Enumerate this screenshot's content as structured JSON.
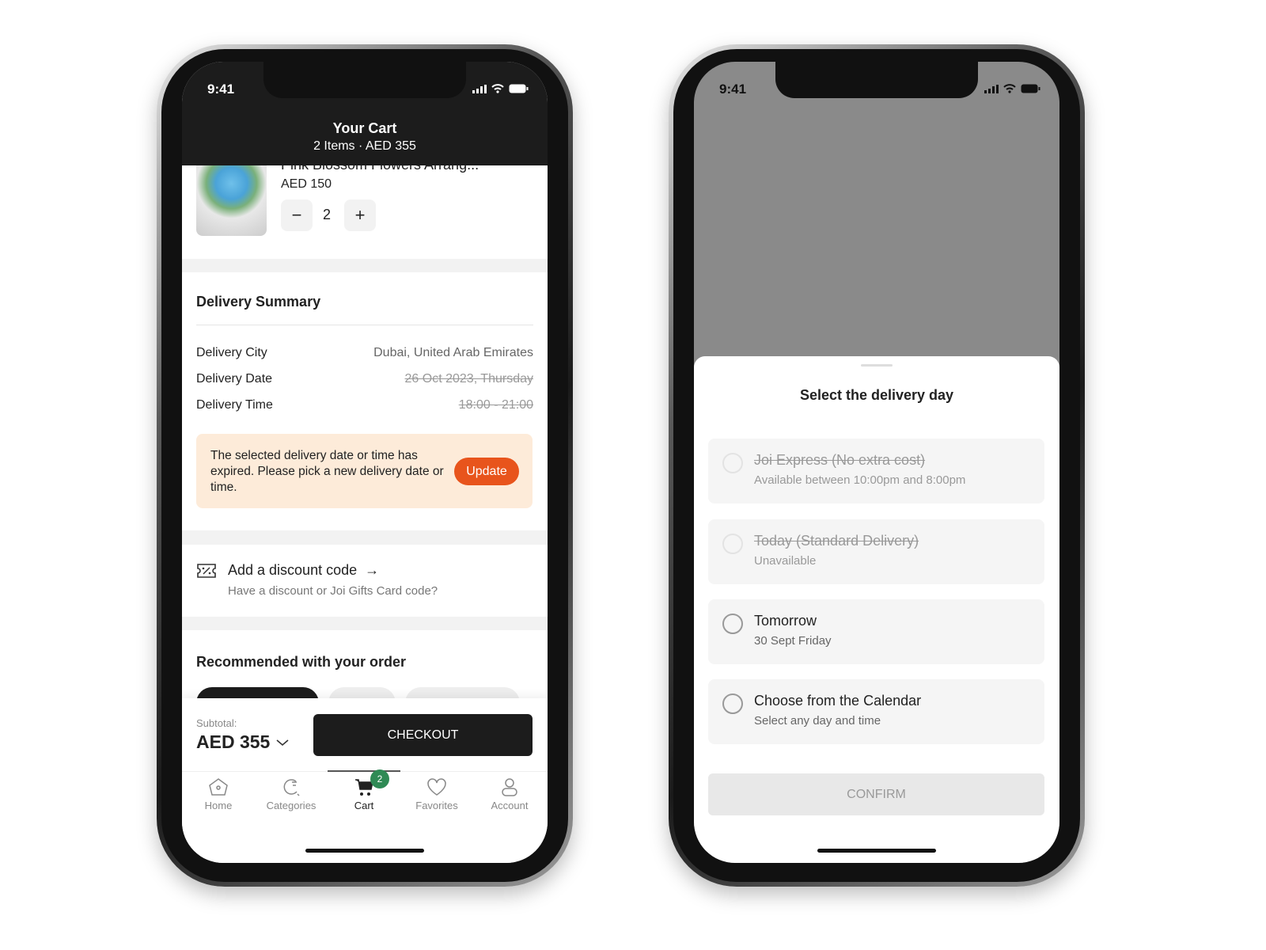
{
  "status": {
    "time": "9:41"
  },
  "cart": {
    "title": "Your Cart",
    "subtitle": "2 Items · AED 355",
    "item": {
      "name": "Pink Blossom Flowers Arrang...",
      "price": "AED 150",
      "quantity": "2"
    },
    "delivery": {
      "heading": "Delivery Summary",
      "rows": [
        {
          "label": "Delivery City",
          "value": "Dubai, United Arab Emirates",
          "expired": false
        },
        {
          "label": "Delivery Date",
          "value": "26 Oct 2023, Thursday",
          "expired": true
        },
        {
          "label": "Delivery Time",
          "value": "18:00 - 21:00",
          "expired": true
        }
      ]
    },
    "warning": {
      "text": "The selected delivery date or time has expired. Please pick a new delivery date or time.",
      "button": "Update"
    },
    "discount": {
      "title": "Add a discount code",
      "subtitle": "Have a discount or Joi Gifts Card code?"
    },
    "recommended": "Recommended with your order",
    "subtotal_label": "Subtotal:",
    "subtotal": "AED 355",
    "checkout": "CHECKOUT",
    "tabs": [
      {
        "label": "Home",
        "icon": "home-icon"
      },
      {
        "label": "Categories",
        "icon": "categories-icon"
      },
      {
        "label": "Cart",
        "icon": "cart-icon",
        "badge": "2",
        "active": true
      },
      {
        "label": "Favorites",
        "icon": "heart-icon"
      },
      {
        "label": "Account",
        "icon": "user-icon"
      }
    ]
  },
  "sheet": {
    "title": "Select the delivery day",
    "options": [
      {
        "title": "Joi Express (No extra cost)",
        "subtitle": "Available between 10:00pm and 8:00pm",
        "disabled": true
      },
      {
        "title": "Today (Standard Delivery)",
        "subtitle": "Unavailable",
        "disabled": true
      },
      {
        "title": "Tomorrow",
        "subtitle": "30 Sept Friday",
        "disabled": false
      },
      {
        "title": "Choose from the Calendar",
        "subtitle": "Select any day and time",
        "disabled": false
      }
    ],
    "confirm": "CONFIRM"
  },
  "colors": {
    "accent": "#e8541c",
    "warning_bg": "#fdebd9",
    "badge": "#2f8a55",
    "dark": "#1c1c1c"
  }
}
